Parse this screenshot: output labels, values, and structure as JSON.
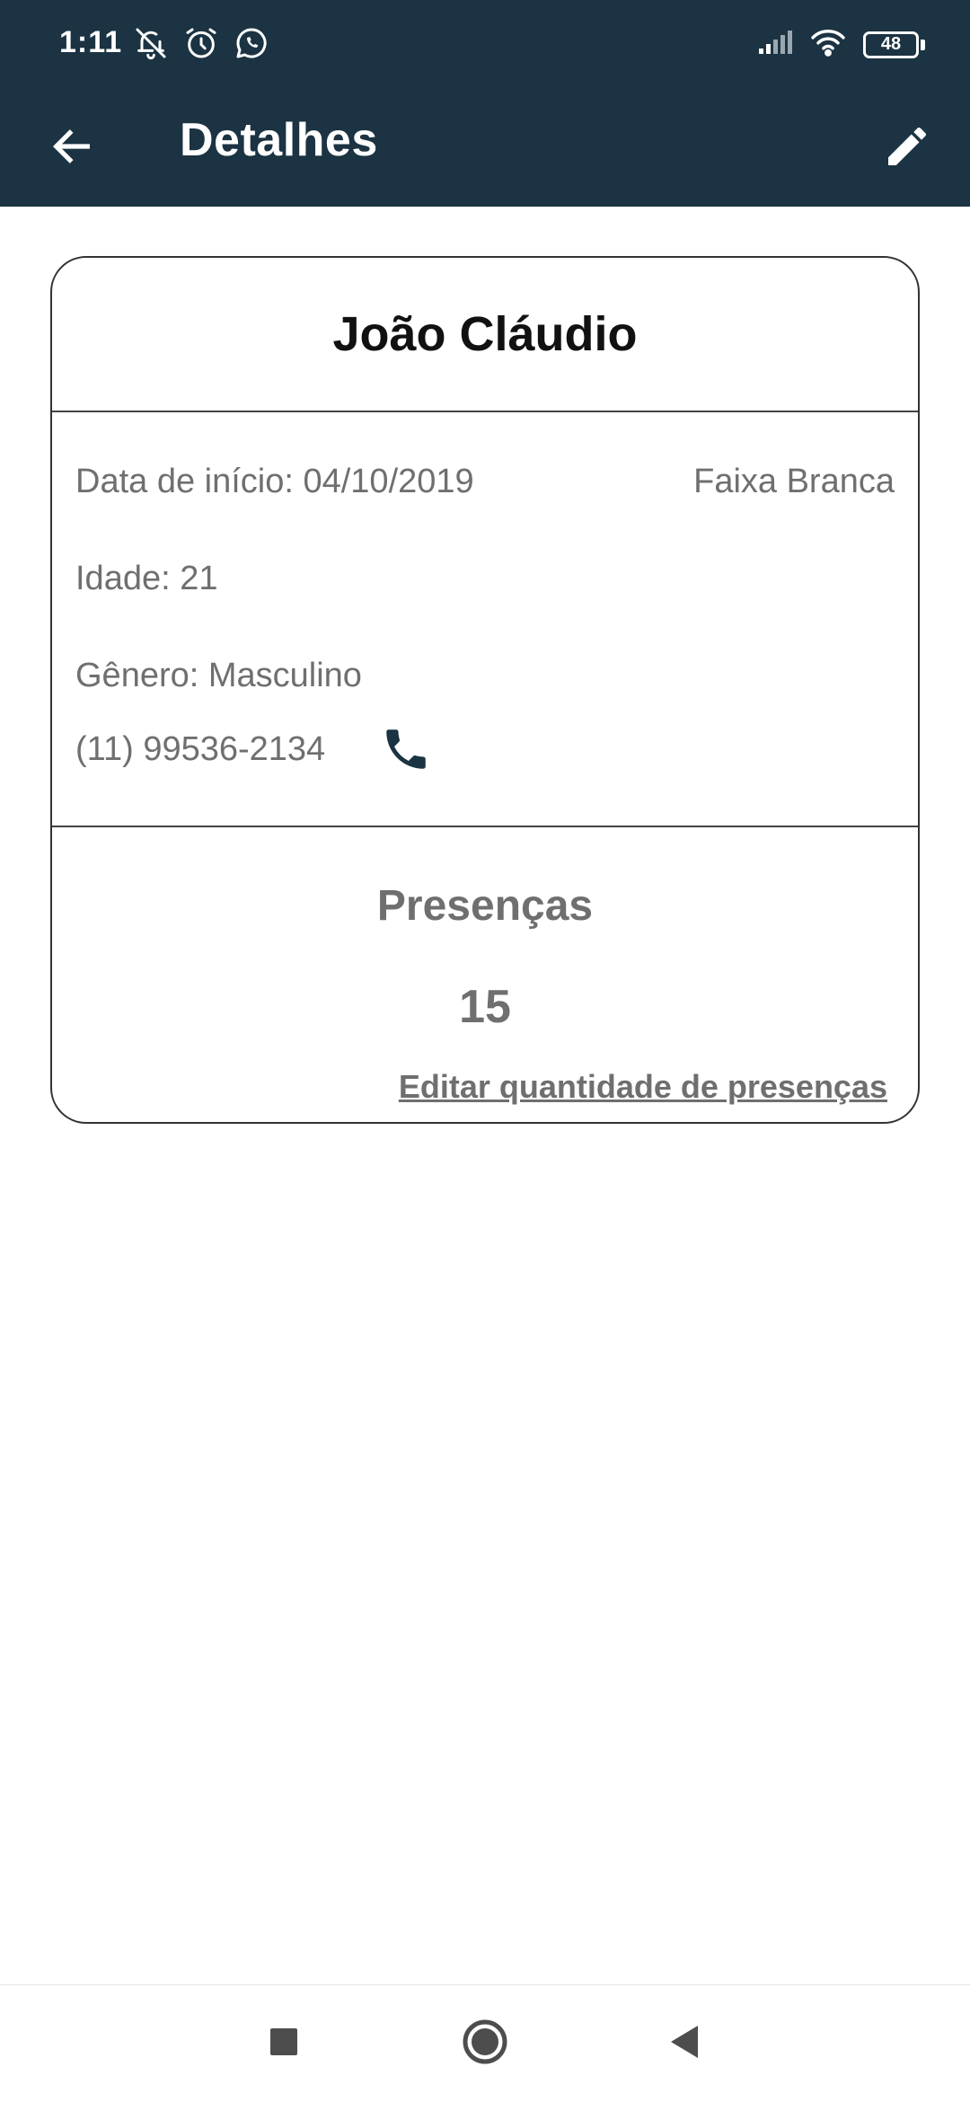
{
  "status_bar": {
    "time": "1:11",
    "battery": "48",
    "icons": [
      "bell-off-icon",
      "alarm-icon",
      "whatsapp-icon",
      "signal-icon",
      "wifi-icon",
      "battery-icon"
    ]
  },
  "app_bar": {
    "title": "Detalhes",
    "back_icon": "arrow-left-icon",
    "edit_icon": "pencil-icon",
    "background": "#1b3342"
  },
  "student": {
    "name": "João Cláudio",
    "start_date": "Data de início: 04/10/2019",
    "belt": "Faixa Branca",
    "age": "Idade: 21",
    "gender": "Gênero: Masculino",
    "phone": "(11) 99536-2134",
    "phone_icon": "phone-icon",
    "phone_icon_color": "#1b3342"
  },
  "presences": {
    "title": "Presenças",
    "count": "15",
    "edit_link": "Editar quantidade de presenças"
  },
  "navigation_bar": {
    "buttons": [
      "recents-square-icon",
      "home-circle-icon",
      "back-triangle-icon"
    ]
  }
}
